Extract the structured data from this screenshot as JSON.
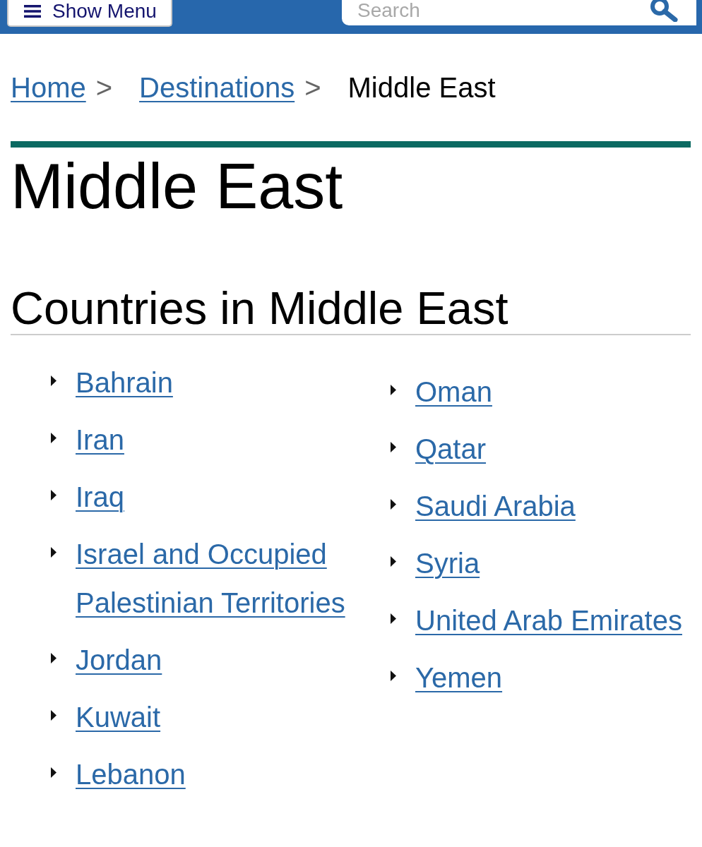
{
  "header": {
    "menu_button": {
      "label": "Show Menu"
    },
    "search": {
      "placeholder": "Search"
    }
  },
  "breadcrumb": [
    {
      "label": "Home",
      "kind": "link",
      "separator": ">"
    },
    {
      "label": "Destinations",
      "kind": "link",
      "separator": ">"
    },
    {
      "label": "Middle East",
      "kind": "current"
    }
  ],
  "page_title": "Middle East",
  "section": {
    "heading": "Countries in Middle East",
    "columns": [
      {
        "items": [
          "Bahrain",
          "Iran",
          "Iraq",
          "Israel and Occupied Palestinian Territories",
          "Jordan",
          "Kuwait",
          "Lebanon"
        ]
      },
      {
        "items": [
          "Oman",
          "Qatar",
          "Saudi Arabia",
          "Syria",
          "United Arab Emirates",
          "Yemen"
        ]
      }
    ]
  }
}
